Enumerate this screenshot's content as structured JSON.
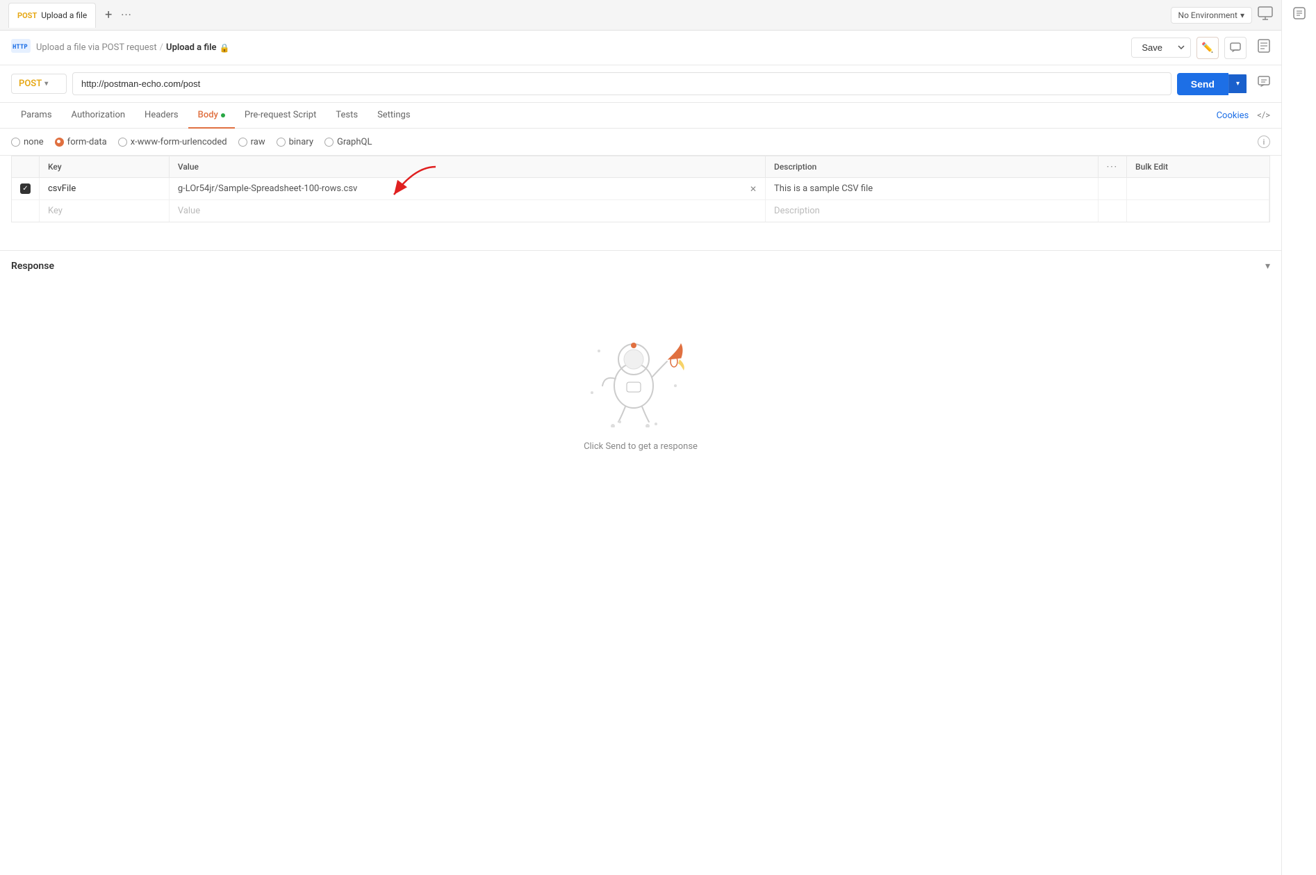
{
  "tab": {
    "post_badge": "POST",
    "title": "Upload a file",
    "plus": "+",
    "more": "···"
  },
  "env_selector": {
    "label": "No Environment",
    "chevron": "▾"
  },
  "header": {
    "breadcrumb_parent": "Upload a file via POST request",
    "separator": "/",
    "current": "Upload a file",
    "save_label": "Save",
    "chevron": "▾"
  },
  "url_bar": {
    "method": "POST",
    "url": "http://postman-echo.com/post",
    "send_label": "Send",
    "send_chevron": "▾",
    "method_chevron": "▾"
  },
  "request_tabs": {
    "tabs": [
      "Params",
      "Authorization",
      "Headers",
      "Body",
      "Pre-request Script",
      "Tests",
      "Settings"
    ],
    "active": "Body",
    "cookies": "Cookies",
    "code": "</>"
  },
  "body_types": [
    {
      "id": "none",
      "label": "none",
      "state": "empty"
    },
    {
      "id": "form-data",
      "label": "form-data",
      "state": "checked-orange"
    },
    {
      "id": "x-www-form-urlencoded",
      "label": "x-www-form-urlencoded",
      "state": "empty"
    },
    {
      "id": "raw",
      "label": "raw",
      "state": "empty"
    },
    {
      "id": "binary",
      "label": "binary",
      "state": "empty"
    },
    {
      "id": "graphql",
      "label": "GraphQL",
      "state": "empty"
    }
  ],
  "table": {
    "headers": [
      "Key",
      "Value",
      "Description",
      "more",
      "Bulk Edit"
    ],
    "rows": [
      {
        "checked": true,
        "key": "csvFile",
        "value": "g-LOr54jr/Sample-Spreadsheet-100-rows.csv",
        "description": "This is a sample CSV file"
      }
    ],
    "empty_row": {
      "key_placeholder": "Key",
      "value_placeholder": "Value",
      "desc_placeholder": "Description"
    }
  },
  "response": {
    "title": "Response",
    "chevron": "▾",
    "empty_text": "Click Send to get a response"
  }
}
